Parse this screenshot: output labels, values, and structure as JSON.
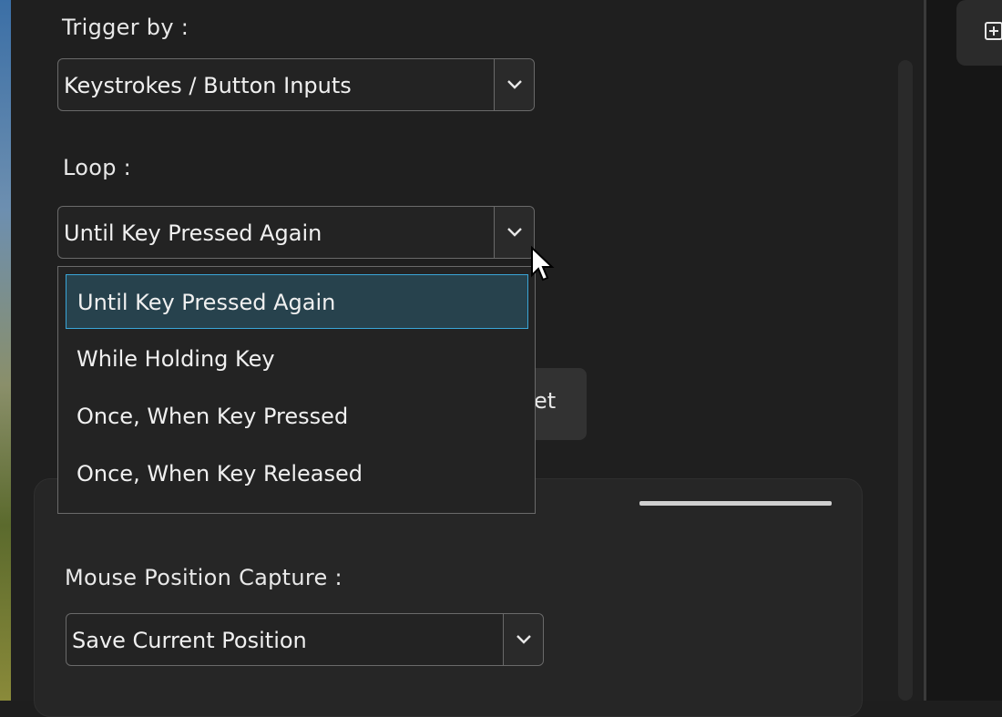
{
  "trigger": {
    "label": "Trigger by :",
    "value": "Keystrokes / Button Inputs"
  },
  "loop": {
    "label": "Loop :",
    "value": "Until Key Pressed Again",
    "options": [
      "Until Key Pressed Again",
      "While Holding Key",
      "Once, When Key Pressed",
      "Once, When Key Released"
    ],
    "selected_index": 0
  },
  "partial_button": {
    "label": "et"
  },
  "mouse_capture": {
    "label": "Mouse Position Capture :",
    "value": "Save Current Position"
  },
  "icons": {
    "dropdown": "chevron-down-icon",
    "add": "add-box-icon",
    "cursor": "mouse-pointer-icon"
  },
  "colors": {
    "highlight_bg": "#27424d",
    "highlight_border": "#3aa6d8",
    "panel_bg": "#1f1f1f"
  }
}
